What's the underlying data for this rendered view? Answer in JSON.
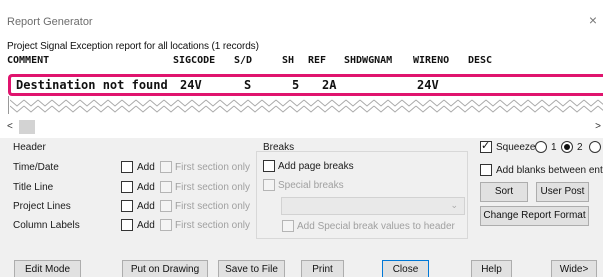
{
  "window": {
    "title": "Report Generator",
    "close_glyph": "×"
  },
  "report": {
    "header": "Project Signal Exception report for all locations (1 records)",
    "columns": [
      "COMMENT",
      "SIGCODE",
      "S/D",
      "SH",
      "REF",
      "SHDWGNAM",
      "WIRENO",
      "DESC"
    ],
    "rows": [
      {
        "comment": "Destination not found",
        "sigcode": "24V",
        "sd": "S",
        "sh": "5",
        "ref": "2A",
        "shdwgnam": "",
        "wireno": "24V",
        "desc": ""
      }
    ]
  },
  "scrollbar": {
    "left": "<",
    "right": ">"
  },
  "header_group": {
    "title": "Header",
    "items": [
      {
        "label": "Time/Date",
        "add": "Add",
        "first": "First section only"
      },
      {
        "label": "Title Line",
        "add": "Add",
        "first": "First section only"
      },
      {
        "label": "Project Lines",
        "add": "Add",
        "first": "First section only"
      },
      {
        "label": "Column Labels",
        "add": "Add",
        "first": "First section only"
      }
    ]
  },
  "breaks_group": {
    "title": "Breaks",
    "add_page_breaks": "Add page breaks",
    "special_breaks": "Special breaks",
    "add_special_values": "Add Special break values to header"
  },
  "right_options": {
    "squeeze": "Squeeze",
    "radio_options": [
      "1",
      "2",
      ""
    ],
    "selected_radio": "2",
    "add_blanks": "Add blanks between entrie",
    "sort": "Sort",
    "user_post": "User Post",
    "change_format": "Change Report Format"
  },
  "bottom_buttons": {
    "edit_mode": "Edit Mode",
    "put_on_drawing": "Put on Drawing",
    "save_to_file": "Save to File",
    "print": "Print",
    "close": "Close",
    "help": "Help",
    "wide": "Wide>"
  },
  "colors": {
    "highlight": "#e0146e",
    "focus": "#0078d7",
    "panel": "#f0f0f0"
  }
}
